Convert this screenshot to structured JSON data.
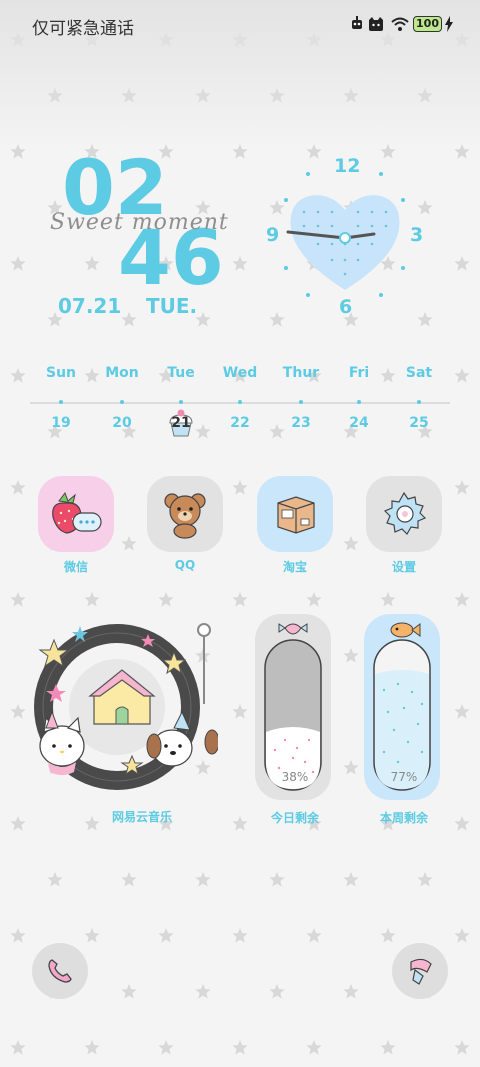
{
  "status_bar": {
    "carrier": "仅可紧急通话",
    "battery": "100",
    "icons": [
      "robot-icon",
      "cat-face-icon",
      "wifi-icon",
      "battery-icon",
      "charging-bolt-icon"
    ]
  },
  "clock": {
    "hour": "02",
    "minute": "46",
    "tagline": "Sweet moment",
    "date": "07.21",
    "weekday": "TUE.",
    "analog": {
      "n12": "12",
      "n3": "3",
      "n6": "6",
      "n9": "9"
    }
  },
  "week": {
    "days": [
      {
        "name": "Sun",
        "num": "19"
      },
      {
        "name": "Mon",
        "num": "20"
      },
      {
        "name": "Tue",
        "num": "21"
      },
      {
        "name": "Wed",
        "num": "22"
      },
      {
        "name": "Thur",
        "num": "23"
      },
      {
        "name": "Fri",
        "num": "24"
      },
      {
        "name": "Sat",
        "num": "25"
      }
    ],
    "today_index": 2
  },
  "apps": [
    {
      "label": "微信",
      "icon": "strawberry-chat-icon"
    },
    {
      "label": "QQ",
      "icon": "teddy-bear-icon"
    },
    {
      "label": "淘宝",
      "icon": "parcel-box-icon"
    },
    {
      "label": "设置",
      "icon": "gear-icon"
    }
  ],
  "widgets": {
    "music": {
      "label": "网易云音乐"
    },
    "today_left": {
      "label": "今日剩余",
      "percent_text": "38%",
      "fraction": 0.38
    },
    "week_left": {
      "label": "本周剩余",
      "percent_text": "77%",
      "fraction": 0.77
    }
  },
  "dock": {
    "left_icon": "phone-icon",
    "right_icon": "paint-roller-icon"
  },
  "colors": {
    "accent": "#5ccbe3",
    "pink": "#f7cfe8",
    "blue_tile": "#c9e6fb",
    "gray_tile": "#e2e2e2"
  }
}
